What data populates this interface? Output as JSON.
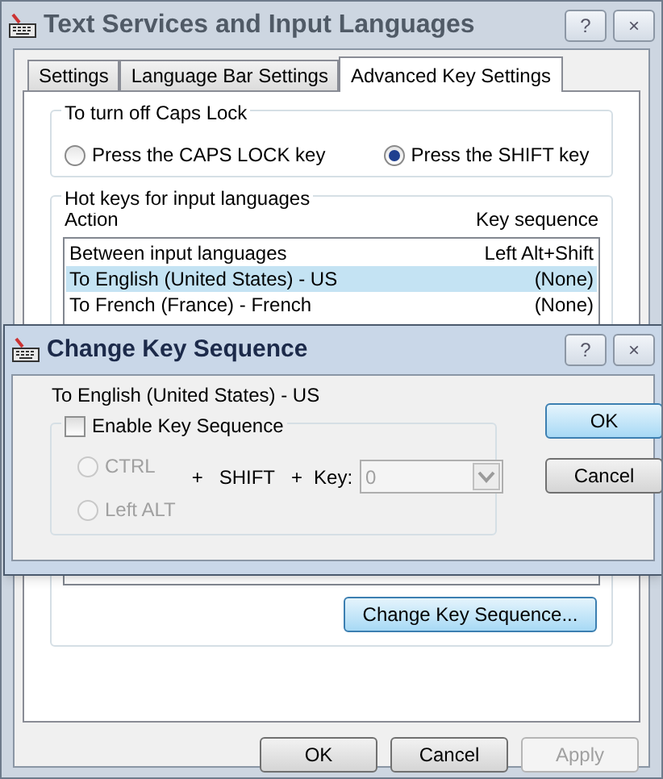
{
  "window": {
    "title": "Text Services and Input Languages",
    "help": "?",
    "close": "×"
  },
  "tabs": [
    {
      "label": "Settings",
      "selected": false
    },
    {
      "label": "Language Bar Settings",
      "selected": false
    },
    {
      "label": "Advanced Key Settings",
      "selected": true
    }
  ],
  "caps_lock": {
    "title": "To turn off Caps Lock",
    "options": [
      {
        "label": "Press the CAPS LOCK key",
        "selected": false
      },
      {
        "label": "Press the SHIFT key",
        "selected": true
      }
    ]
  },
  "hot_keys": {
    "title": "Hot keys for input languages",
    "columns": [
      "Action",
      "Key sequence"
    ],
    "rows": [
      {
        "action": "Between input languages",
        "key_sequence": "Left Alt+Shift",
        "selected": false
      },
      {
        "action": "To English (United States) - US",
        "key_sequence": "(None)",
        "selected": true
      },
      {
        "action": "To French (France) - French",
        "key_sequence": "(None)",
        "selected": false
      }
    ],
    "button": "Change Key Sequence..."
  },
  "buttons": [
    {
      "label": "OK",
      "disabled": false
    },
    {
      "label": "Cancel",
      "disabled": false
    },
    {
      "label": "Apply",
      "disabled": true
    }
  ],
  "dialog": {
    "title": "Change Key Sequence",
    "help": "?",
    "close": "×",
    "subject": "To English (United States) - US",
    "enable": {
      "label": "Enable Key Sequence",
      "checked": false
    },
    "modifiers": [
      {
        "label": "CTRL",
        "selected": false
      },
      {
        "label": "Left ALT",
        "selected": false
      }
    ],
    "plus_1": "+",
    "shift": "SHIFT",
    "plus_2": "+",
    "key_label": "Key:",
    "key_value": "0",
    "buttons": [
      {
        "label": "OK",
        "default": true
      },
      {
        "label": "Cancel",
        "default": false
      }
    ]
  }
}
